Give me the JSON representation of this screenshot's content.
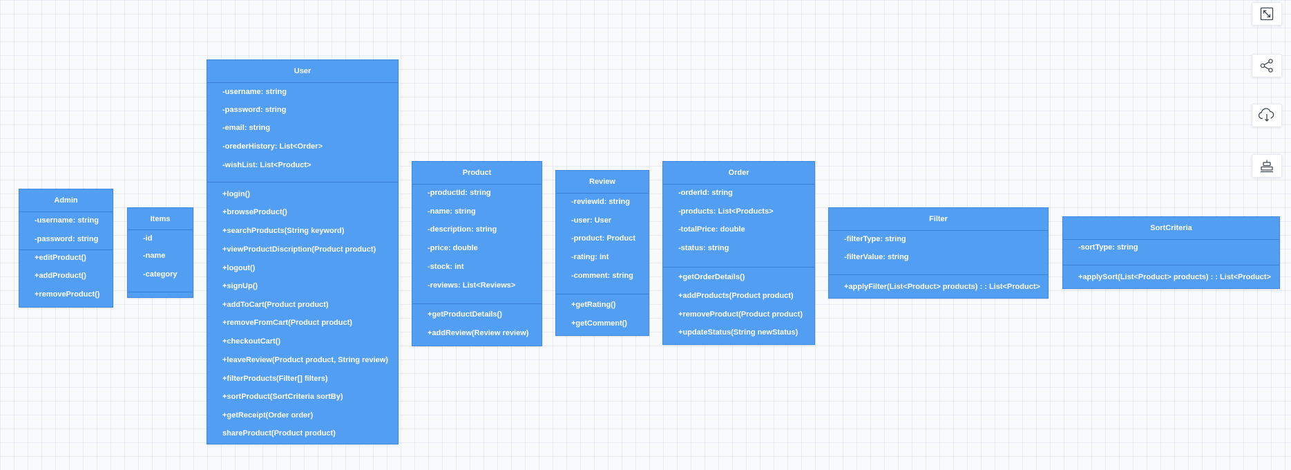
{
  "diagram": {
    "classes": {
      "admin": {
        "name": "Admin",
        "attributes": [
          "-username: string",
          "-password: string"
        ],
        "methods": [
          "+editProduct()",
          "+addProduct()",
          "+removeProduct()"
        ]
      },
      "items": {
        "name": "Items",
        "attributes": [
          "-id",
          "-name",
          "-category"
        ],
        "methods": []
      },
      "user": {
        "name": "User",
        "attributes": [
          "-username: string",
          "-password: string",
          "-email: string",
          "-orederHistory: List<Order>",
          "-wishList: List<Product>"
        ],
        "methods": [
          "+login()",
          "+browseProduct()",
          "+searchProducts(String keyword)",
          "+viewProductDiscription(Product product)",
          "+logout()",
          "+signUp()",
          "+addToCart(Product product)",
          "+removeFromCart(Product product)",
          "+checkoutCart()",
          "+leaveReview(Product product, String review)",
          "+filterProducts(Filter[] filters)",
          "+sortProduct(SortCriteria sortBy)",
          "+getReceipt(Order order)",
          "shareProduct(Product product)"
        ]
      },
      "product": {
        "name": "Product",
        "attributes": [
          "-productId: string",
          "-name: string",
          "-description: string",
          "-price: double",
          "-stock: int",
          "-reviews: List<Reviews>"
        ],
        "methods": [
          "+getProductDetails()",
          "+addReview(Review review)"
        ]
      },
      "review": {
        "name": "Review",
        "attributes": [
          "-reviewId: string",
          "-user: User",
          "-product: Product",
          "-rating: int",
          "-comment: string"
        ],
        "methods": [
          "+getRating()",
          "+getComment()"
        ]
      },
      "order": {
        "name": "Order",
        "attributes": [
          "-orderId: string",
          "-products: List<Products>",
          "-totalPrice: double",
          "-status: string"
        ],
        "methods": [
          "+getOrderDetails()",
          "+addProducts(Product product)",
          "+removeProduct(Product product)",
          "+updateStatus(String newStatus)"
        ]
      },
      "filter": {
        "name": "Filter",
        "attributes": [
          "-filterType: string",
          "-filterValue: string"
        ],
        "methods": [
          "+applyFilter(List<Product> products) : : List<Product>"
        ]
      },
      "sortcriteria": {
        "name": "SortCriteria",
        "attributes": [
          "-sortType: string"
        ],
        "methods": [
          "+applySort(List<Product> products) : : List<Product>"
        ]
      }
    }
  },
  "toolbar": {
    "icons": [
      "fullscreen-icon",
      "share-icon",
      "cloud-download-icon",
      "align-center-icon"
    ]
  },
  "colors": {
    "class_fill": "#519ef3",
    "class_border": "#3f89de",
    "class_text": "#ffffff",
    "background": "#f9fafc"
  }
}
